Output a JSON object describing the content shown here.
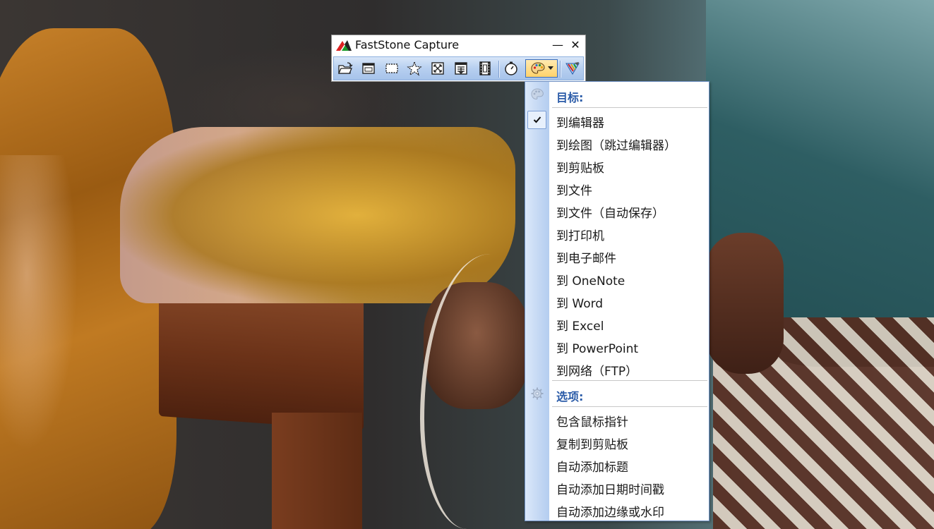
{
  "window": {
    "title": "FastStone Capture",
    "minimize_glyph": "—",
    "close_glyph": "✕"
  },
  "toolbar": {
    "buttons": [
      {
        "icon": "open-folder-icon"
      },
      {
        "icon": "capture-window-icon"
      },
      {
        "icon": "capture-rectangle-icon"
      },
      {
        "icon": "capture-freehand-icon"
      },
      {
        "icon": "capture-fullscreen-icon"
      },
      {
        "icon": "capture-scrolling-icon"
      },
      {
        "icon": "screen-recorder-icon"
      },
      {
        "icon": "delay-timer-icon"
      },
      {
        "icon": "output-destination-icon"
      },
      {
        "icon": "settings-brush-icon"
      }
    ]
  },
  "menu": {
    "target_header": "目标:",
    "targets": [
      {
        "label": "到编辑器",
        "checked": true
      },
      {
        "label": "到绘图（跳过编辑器）",
        "checked": false
      },
      {
        "label": "到剪贴板",
        "checked": false
      },
      {
        "label": "到文件",
        "checked": false
      },
      {
        "label": "到文件（自动保存）",
        "checked": false
      },
      {
        "label": "到打印机",
        "checked": false
      },
      {
        "label": "到电子邮件",
        "checked": false
      },
      {
        "label": "到 OneNote",
        "checked": false
      },
      {
        "label": "到 Word",
        "checked": false
      },
      {
        "label": "到 Excel",
        "checked": false
      },
      {
        "label": "到 PowerPoint",
        "checked": false
      },
      {
        "label": "到网络（FTP）",
        "checked": false
      }
    ],
    "options_header": "选项:",
    "options": [
      {
        "label": "包含鼠标指针"
      },
      {
        "label": "复制到剪贴板"
      },
      {
        "label": "自动添加标题"
      },
      {
        "label": "自动添加日期时间戳"
      },
      {
        "label": "自动添加边缘或水印"
      }
    ]
  },
  "colors": {
    "menu_header": "#2a5ba8",
    "toolbar_gradient_top": "#d8e6f8",
    "toolbar_gradient_bottom": "#a6c3ea",
    "menu_border": "#6d8fc4"
  }
}
